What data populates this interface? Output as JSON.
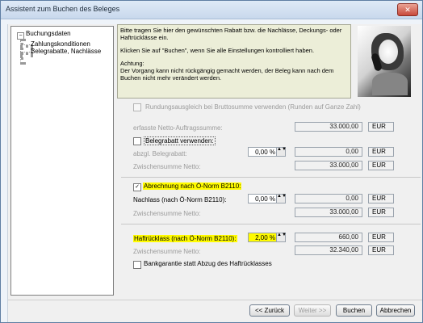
{
  "window": {
    "title": "Assistent zum Buchen des Beleges",
    "close_glyph": "✕"
  },
  "tree": {
    "root": "Buchungsdaten",
    "items": [
      "Zahlungskonditionen",
      "Belegrabatte, Nachlässe"
    ],
    "expander": "−"
  },
  "info": {
    "line1": "Bitte tragen Sie hier den gewünschten Rabatt bzw. die Nachlässe, Deckungs- oder",
    "line2": "Haftrücklässe ein.",
    "line3": "Klicken Sie auf \"Buchen\", wenn Sie alle Einstellungen kontrolliert haben.",
    "line4": "Achtung:",
    "line5": "Der Vorgang kann nicht rückgängig gemacht werden, der Beleg kann nach dem",
    "line6": "Buchen nicht mehr verändert werden."
  },
  "form": {
    "rundung": {
      "label": "Rundungsausgleich bei Bruttosumme verwenden (Runden auf Ganze Zahl)",
      "checked": false
    },
    "netto": {
      "label": "erfasste Netto-Auftragssumme:",
      "value": "33.000,00",
      "unit": "EUR"
    },
    "belegrabatt": {
      "label": "Belegrabatt verwenden:",
      "checked": false
    },
    "abzgl": {
      "label": "abzgl. Belegrabatt:",
      "percent": "0,00 %",
      "value": "0,00",
      "unit": "EUR"
    },
    "zwischen1": {
      "label": "Zwischensumme Netto:",
      "value": "33.000,00",
      "unit": "EUR"
    },
    "abrechnung": {
      "label": "Abrechnung nach Ö-Norm B2110:",
      "checked": true
    },
    "nachlass": {
      "label": "Nachlass (nach Ö-Norm B2110):",
      "percent": "0,00 %",
      "value": "0,00",
      "unit": "EUR"
    },
    "zwischen2": {
      "label": "Zwischensumme Netto:",
      "value": "33.000,00",
      "unit": "EUR"
    },
    "haft": {
      "label": "Haftrücklass (nach Ö-Norm B2110):",
      "percent": "2,00 %",
      "value": "660,00",
      "unit": "EUR"
    },
    "zwischen3": {
      "label": "Zwischensumme Netto:",
      "value": "32.340,00",
      "unit": "EUR"
    },
    "bank": {
      "label": "Bankgarantie statt Abzug des Haftrücklasses",
      "checked": false
    }
  },
  "buttons": {
    "back": "<< Zurück",
    "next": "Weiter >>",
    "book": "Buchen",
    "cancel": "Abbrechen"
  },
  "icons": {
    "spin": "▲▼",
    "check_mark": "✓"
  },
  "colors": {
    "highlight": "#fffb00",
    "info_bg": "#eceed8"
  }
}
